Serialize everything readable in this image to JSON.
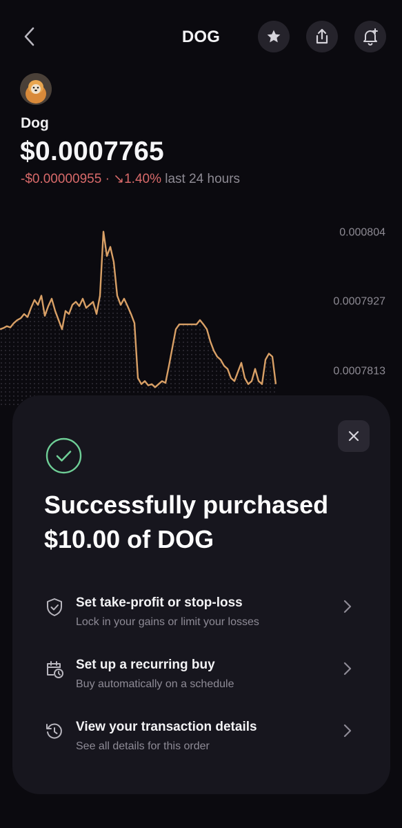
{
  "header": {
    "title": "DOG",
    "back_icon": "chevron-left-icon",
    "actions": [
      "star-icon",
      "share-icon",
      "bell-plus-icon"
    ]
  },
  "asset": {
    "name": "Dog",
    "price": "$0.0007765",
    "change_abs": "-$0.00000955",
    "separator": "·",
    "change_pct": "↘1.40%",
    "period": "last 24 hours"
  },
  "chart_data": {
    "type": "line",
    "y_ticks": [
      "0.000804",
      "0.0007927",
      "0.0007813"
    ],
    "ylim": [
      0.0007775,
      0.000806
    ],
    "line_color": "#d9a066",
    "x": [
      0,
      5,
      10,
      15,
      20,
      25,
      30,
      35,
      40,
      45,
      50,
      55,
      60,
      65,
      70,
      75,
      80,
      85,
      90,
      95,
      100,
      105,
      110,
      115,
      120,
      125,
      130,
      135,
      140,
      145,
      150,
      155,
      160,
      165,
      170,
      175,
      180,
      185,
      190,
      195,
      200,
      205,
      210,
      215,
      220,
      225,
      230,
      235,
      240,
      245,
      250,
      255,
      260,
      265,
      270,
      275,
      280,
      285,
      290,
      295,
      300,
      305,
      310,
      315,
      320,
      325,
      330,
      335,
      340,
      345,
      350,
      355,
      360,
      365,
      370,
      375,
      380,
      385,
      390,
      395,
      400
    ],
    "values": [
      0.000788,
      0.0007882,
      0.0007885,
      0.0007883,
      0.000789,
      0.0007895,
      0.0007898,
      0.0007905,
      0.00079,
      0.0007915,
      0.0007928,
      0.000792,
      0.0007935,
      0.0007902,
      0.0007918,
      0.000793,
      0.000791,
      0.0007895,
      0.000788,
      0.000791,
      0.0007905,
      0.000792,
      0.0007925,
      0.0007918,
      0.000793,
      0.0007915,
      0.000792,
      0.0007925,
      0.0007905,
      0.0007935,
      0.000804,
      0.0008,
      0.0008015,
      0.000799,
      0.0007935,
      0.000792,
      0.000793,
      0.0007918,
      0.0007905,
      0.000789,
      0.00078,
      0.000779,
      0.0007795,
      0.0007788,
      0.000779,
      0.0007785,
      0.000779,
      0.0007795,
      0.0007792,
      0.000782,
      0.000785,
      0.000788,
      0.0007888,
      0.0007888,
      0.0007888,
      0.0007888,
      0.0007888,
      0.0007888,
      0.0007895,
      0.0007888,
      0.000788,
      0.000786,
      0.0007845,
      0.0007835,
      0.000783,
      0.000782,
      0.0007815,
      0.00078,
      0.0007795,
      0.000781,
      0.0007825,
      0.00078,
      0.000779,
      0.0007795,
      0.0007815,
      0.0007795,
      0.000779,
      0.000783,
      0.000784,
      0.0007835,
      0.000779
    ]
  },
  "sheet": {
    "close_icon": "close-icon",
    "success_icon": "check-circle-icon",
    "title_line1": "Successfully purchased",
    "title_line2": "$10.00 of DOG",
    "actions": [
      {
        "icon": "shield-check-icon",
        "title": "Set take-profit or stop-loss",
        "subtitle": "Lock in your gains or limit your losses"
      },
      {
        "icon": "calendar-clock-icon",
        "title": "Set up a recurring buy",
        "subtitle": "Buy automatically on a schedule"
      },
      {
        "icon": "history-icon",
        "title": "View your transaction details",
        "subtitle": "See all details for this order"
      }
    ]
  },
  "colors": {
    "background": "#0b0a0f",
    "sheet": "#17161e",
    "negative": "#d96a6a",
    "success": "#6fcf97",
    "chart_line": "#d9a066"
  }
}
